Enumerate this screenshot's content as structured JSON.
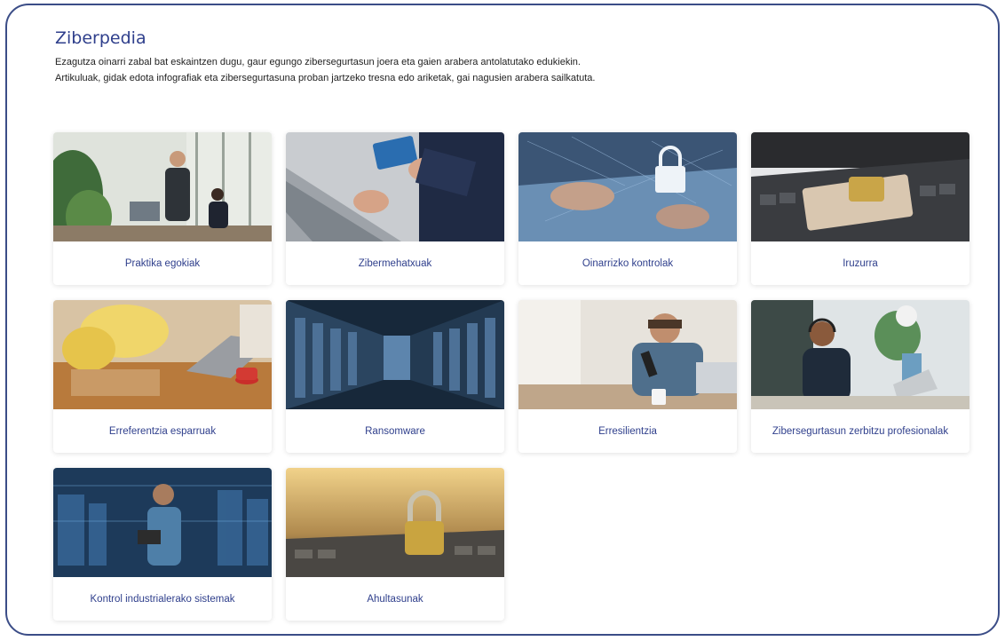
{
  "page": {
    "title": "Ziberpedia",
    "intro_line1": "Ezagutza oinarri zabal bat eskaintzen dugu, gaur egungo zibersegurtasun joera eta gaien arabera antolatutako edukiekin.",
    "intro_line2": "Artikuluak, gidak edota infografiak eta zibersegurtasuna proban jartzeko tresna edo ariketak, gai nagusien arabera sailkatuta."
  },
  "cards": [
    {
      "label": "Praktika egokiak",
      "image": "office-meeting-photo"
    },
    {
      "label": "Zibermehatxuak",
      "image": "credit-card-laptop-photo"
    },
    {
      "label": "Oinarrizko kontrolak",
      "image": "keyboard-padlock-photo"
    },
    {
      "label": "Iruzurra",
      "image": "cards-padlock-keyboard-photo"
    },
    {
      "label": "Erreferentzia esparruak",
      "image": "desk-laptop-cup-photo"
    },
    {
      "label": "Ransomware",
      "image": "server-room-photo"
    },
    {
      "label": "Erresilientzia",
      "image": "stressed-man-phone-photo"
    },
    {
      "label": "Zibersegurtasun zerbitzu profesionalak",
      "image": "headset-woman-photo"
    },
    {
      "label": "Kontrol industrialerako sistemak",
      "image": "industrial-engineer-photo"
    },
    {
      "label": "Ahultasunak",
      "image": "padlock-keyboard-photo"
    }
  ]
}
